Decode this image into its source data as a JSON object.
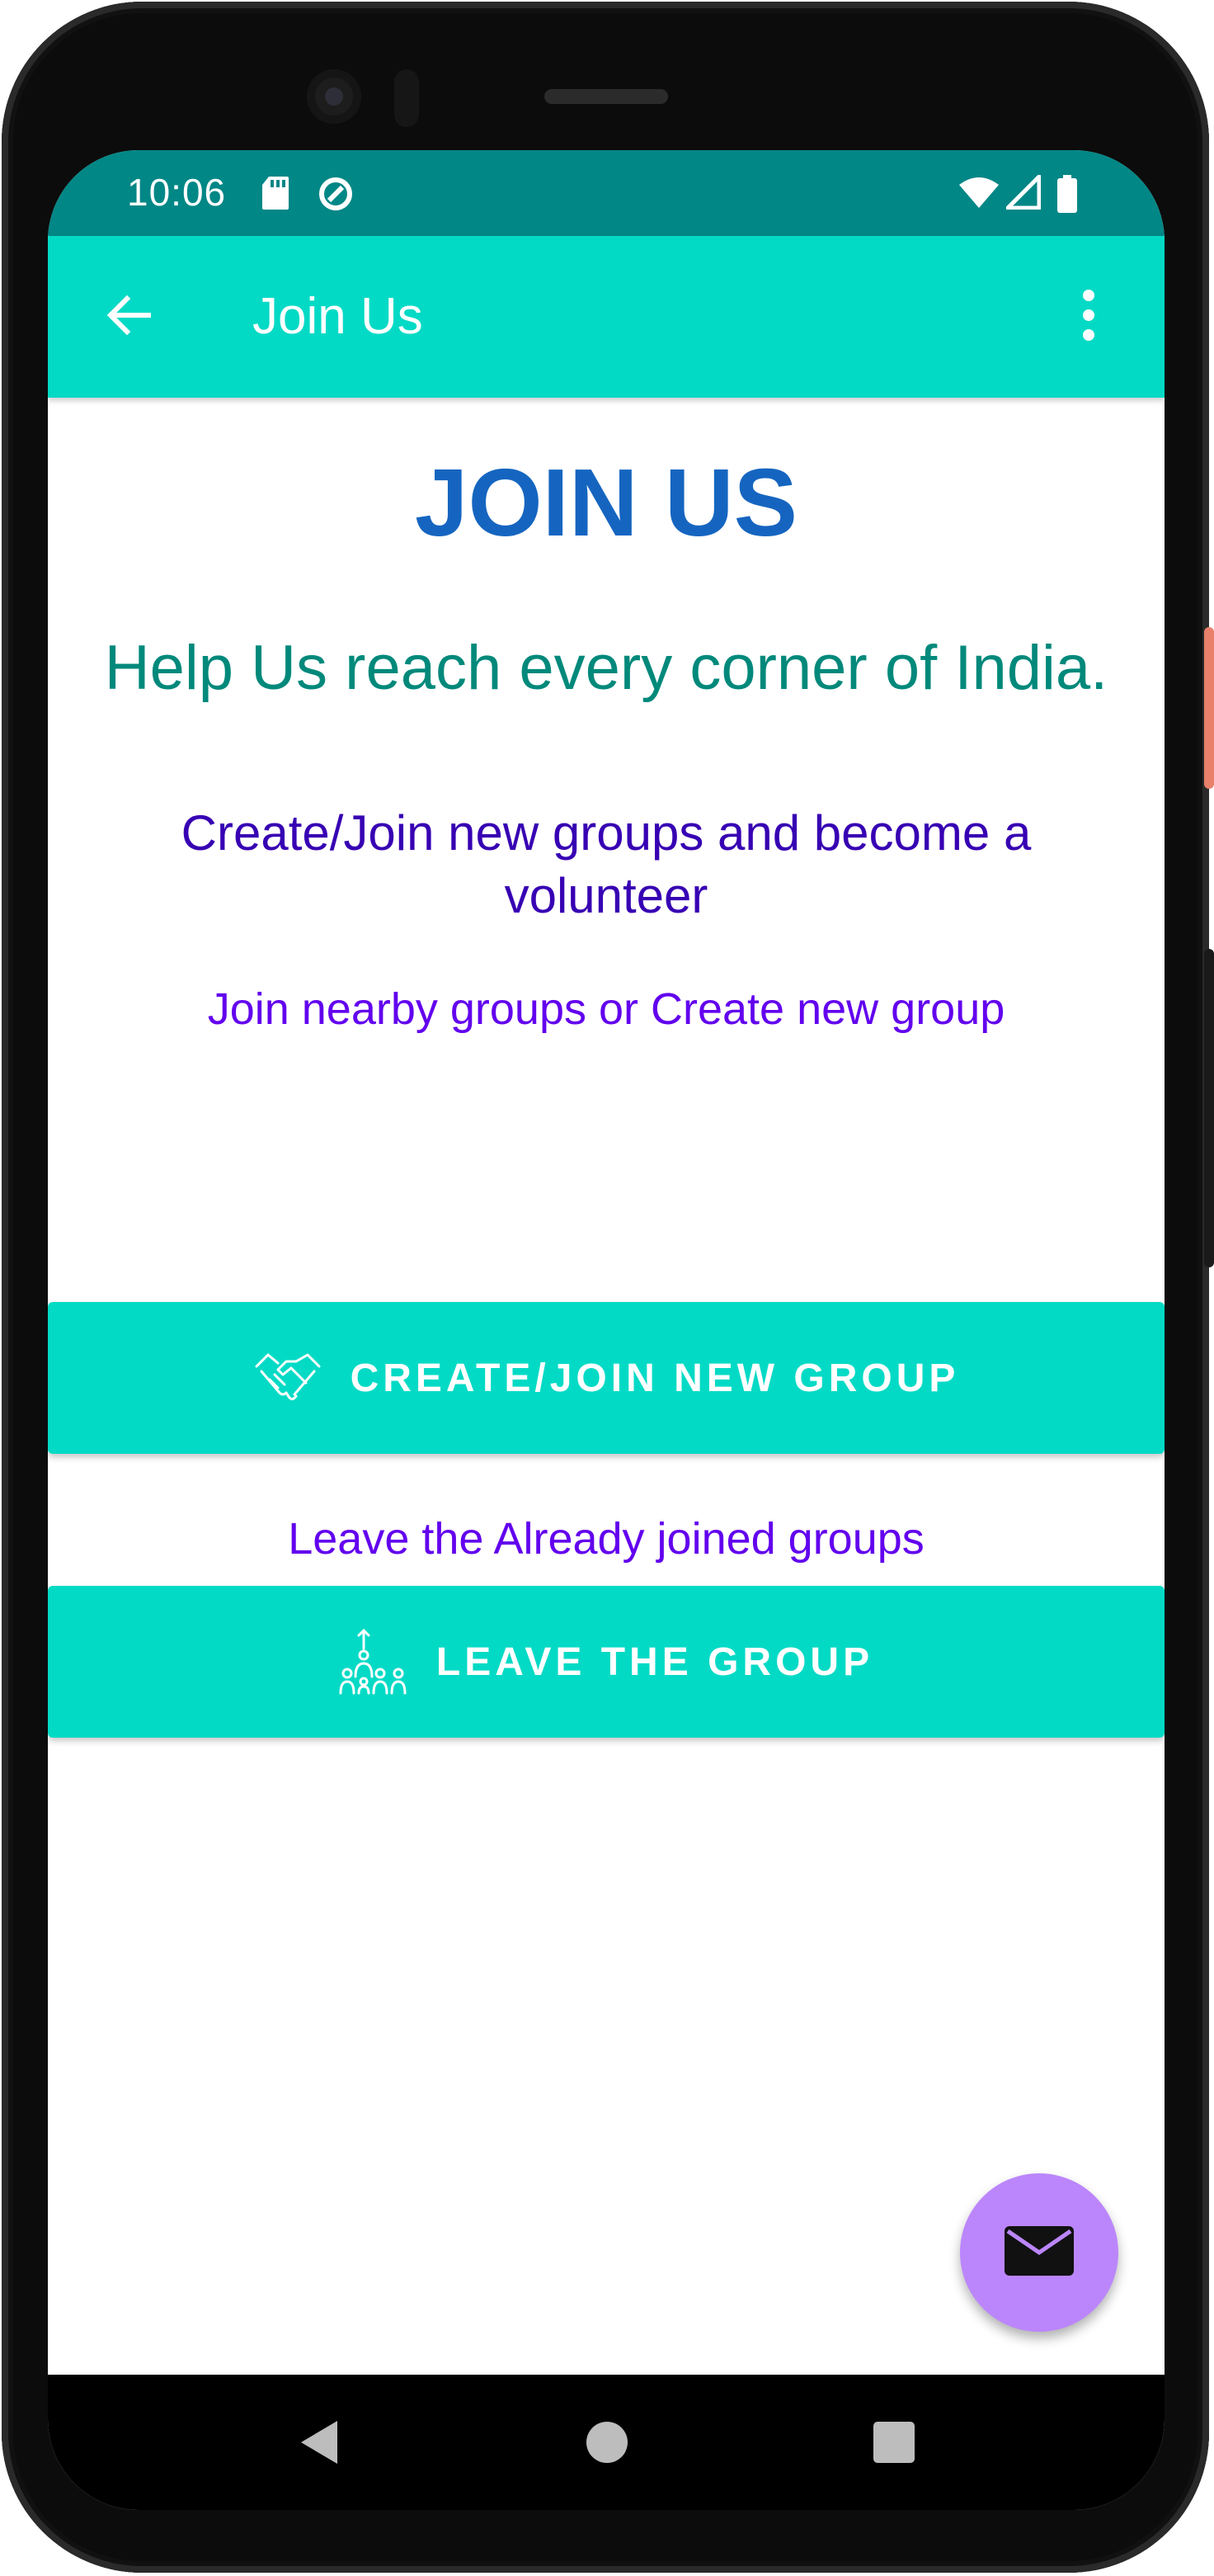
{
  "status_bar": {
    "time": "10:06",
    "left_icons": [
      "sd-card-icon",
      "data-saver-icon"
    ],
    "right_icons": [
      "wifi-icon",
      "cellular-signal-icon",
      "battery-icon"
    ]
  },
  "app_bar": {
    "title": "Join Us",
    "back_icon": "arrow-back-icon",
    "menu_icon": "more-vert-icon"
  },
  "main": {
    "heading": "JOIN US",
    "tagline": "Help Us reach every corner of India.",
    "subtitle": "Create/Join new groups and become a volunteer",
    "join_hint": "Join nearby groups or Create new group",
    "create_button": {
      "label": "CREATE/JOIN NEW GROUP",
      "icon": "handshake-icon"
    },
    "leave_hint": "Leave the Already joined groups",
    "leave_button": {
      "label": "LEAVE THE GROUP",
      "icon": "group-leave-icon"
    }
  },
  "fab": {
    "icon": "email-icon"
  },
  "nav_bar": {
    "buttons": [
      "back-triangle-icon",
      "home-circle-icon",
      "recents-square-icon"
    ]
  },
  "colors": {
    "status_bar": "#018786",
    "app_bar": "#03dac5",
    "heading": "#1565c0",
    "tagline": "#00897b",
    "subtitle": "#3700b3",
    "hint": "#6200ee",
    "fab": "#bb86fc"
  }
}
